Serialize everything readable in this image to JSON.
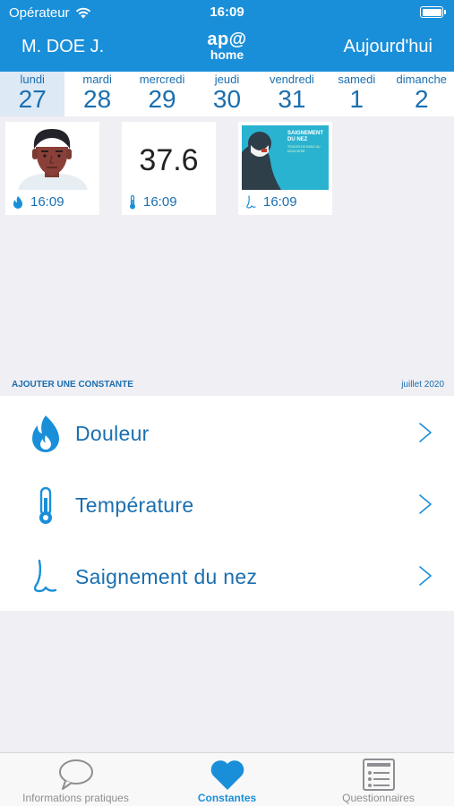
{
  "status": {
    "carrier": "Opérateur",
    "time": "16:09"
  },
  "header": {
    "user": "M. DOE J.",
    "logo_top": "ap@",
    "logo_bottom": "home",
    "today": "Aujourd'hui"
  },
  "week": [
    {
      "name": "lundi",
      "num": "27",
      "selected": true
    },
    {
      "name": "mardi",
      "num": "28",
      "selected": false
    },
    {
      "name": "mercredi",
      "num": "29",
      "selected": false
    },
    {
      "name": "jeudi",
      "num": "30",
      "selected": false
    },
    {
      "name": "vendredi",
      "num": "31",
      "selected": false
    },
    {
      "name": "samedi",
      "num": "1",
      "selected": false
    },
    {
      "name": "dimanche",
      "num": "2",
      "selected": false
    }
  ],
  "cards": [
    {
      "type": "pain",
      "icon": "flame-icon",
      "time": "16:09"
    },
    {
      "type": "temperature",
      "icon": "thermometer-icon",
      "value": "37.6",
      "time": "16:09"
    },
    {
      "type": "nosebleed",
      "icon": "nose-icon",
      "time": "16:09",
      "poster_title_1": "SAIGNEMENT",
      "poster_title_2": "DU NEZ",
      "poster_sub": "TRACES DE SANG AU MOUCHOIR"
    }
  ],
  "section": {
    "title": "AJOUTER UNE CONSTANTE",
    "month": "juillet 2020"
  },
  "constants": [
    {
      "label": "Douleur",
      "icon": "flame-icon"
    },
    {
      "label": "Température",
      "icon": "thermometer-icon"
    },
    {
      "label": "Saignement du nez",
      "icon": "nose-icon"
    }
  ],
  "tabs": [
    {
      "label": "Informations pratiques",
      "icon": "chat-bubble-icon",
      "active": false
    },
    {
      "label": "Constantes",
      "icon": "heart-icon",
      "active": true
    },
    {
      "label": "Questionnaires",
      "icon": "form-icon",
      "active": false
    }
  ],
  "colors": {
    "brand": "#1a8fd9",
    "text_blue": "#1a6fb0",
    "background": "#efeff4"
  }
}
